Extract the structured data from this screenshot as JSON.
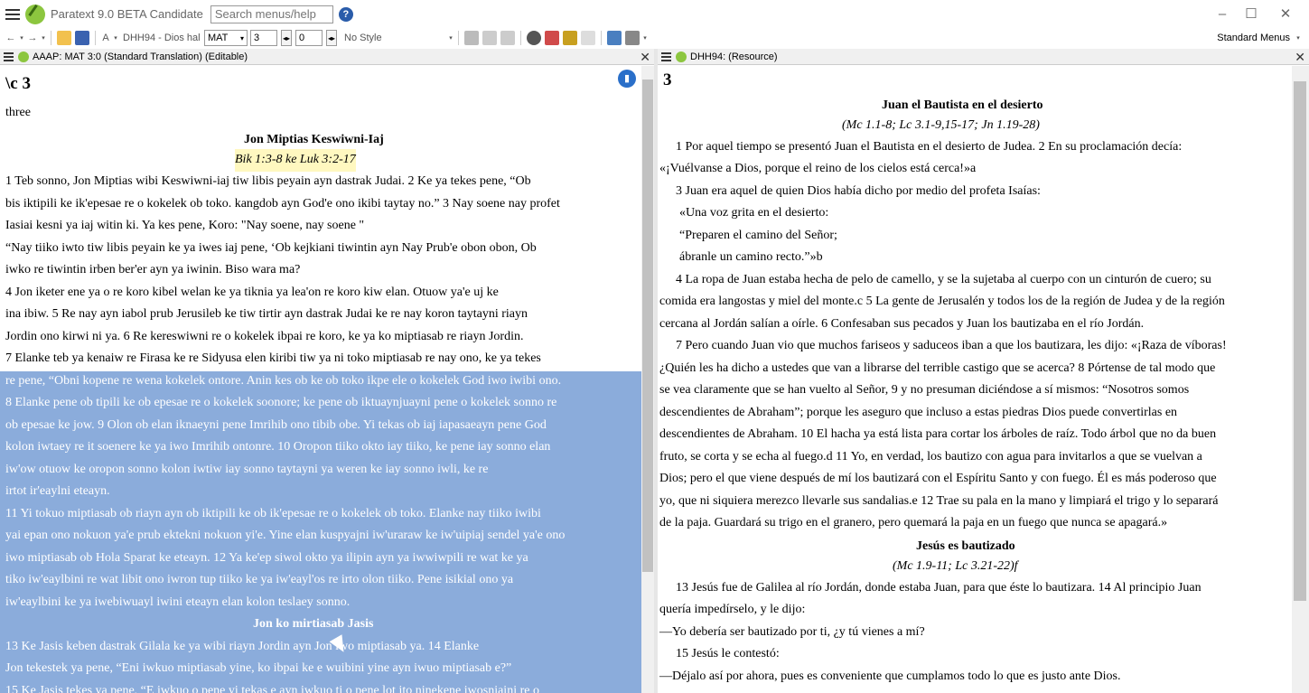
{
  "window": {
    "title": "Paratext 9.0 BETA Candidate",
    "search_placeholder": "Search menus/help",
    "help_glyph": "?",
    "minimize": "–",
    "maximize": "☐",
    "close": "✕"
  },
  "toolbar": {
    "font_label": "A",
    "resource_label": "DHH94 - Dios hal",
    "book": "MAT",
    "chapter": "3",
    "verse": "0",
    "style": "No Style",
    "menus_label": "Standard Menus"
  },
  "left_pane": {
    "title": "AAAP: MAT 3:0 (Standard Translation) (Editable)",
    "close": "✕",
    "lines": [
      "\\c 3",
      "three",
      "Jon Miptias Keswiwni-Iaj",
      "Bik 1:3-8 ke Luk 3:2-17",
      "1 Teb sonno, Jon Miptias wibi Keswiwni-iaj tiw libis peyain ayn dastrak Judai. 2 Ke ya tekes pene, “Ob",
      "bis iktipili ke ik'epesae re o kokelek ob toko. kangdob ayn God'e ono ikibi taytay no.” 3 Nay soene nay profet",
      "Iasiai kesni ya iaj witin ki. Ya kes pene, Koro: \"Nay soene, nay soene \"",
      "“Nay tiiko iwto tiw libis peyain ke ya iwes iaj pene, ‘Ob kejkiani tiwintin ayn Nay Prub'e obon obon, Ob",
      "iwko re tiwintin irben ber'er ayn ya iwinin. Biso wara ma?",
      "4 Jon iketer ene ya o re koro kibel welan ke ya tiknia ya lea'on re koro kiw elan. Otuow ya'e uj ke",
      "ina ibiw. 5 Re nay ayn iabol prub Jerusileb ke tiw tirtir ayn dastrak Judai ke re nay koron taytayni riayn",
      "Jordin ono kirwi ni ya. 6 Re kereswiwni re o kokelek ibpai re koro, ke ya ko miptiasab re riayn Jordin.",
      "7 Elanke teb ya kenaiw re Firasa ke re Sidyusa elen kiribi tiw ya ni toko miptiasab re nay ono, ke ya tekes",
      "re pene, “Obni kopene re wena kokelek ontore. Anin kes ob ke ob toko ikpe ele o kokelek God iwo iwibi ono.",
      "8 Elanke pene ob tipili ke ob epesae re o kokelek soonore; ke pene ob iktuaynjuayni pene o kokelek sonno re",
      "ob epesae ke jow. 9 Olon ob elan iknaeyni pene Imrihib ono tibib obe. Yi tekas ob iaj iapasaeayn pene God",
      "kolon iwtaey re it soenere ke ya iwo Imrihib ontonre. 10 Oropon tiiko okto iay tiiko, ke pene iay sonno elan",
      "iw'ow otuow ke oropon sonno kolon iwtiw iay sonno taytayni ya weren ke iay sonno iwli, ke re",
      "irtot ir'eaylni eteayn.",
      "11 Yi tokuo miptiasab ob riayn ayn ob iktipili ke ob ik'epesae re o kokelek ob toko. Elanke nay tiiko iwibi",
      "yai epan ono nokuon ya'e prub ektekni nokuon yi'e. Yine elan kuspyajni iw'uraraw ke iw'uipiaj sendel ya'e ono",
      "iwo miptiasab ob Hola Sparat ke eteayn. 12 Ya ke'ep siwol okto ya ilipin ayn ya iwwiwpili re wat ke ya",
      "tiko iw'eaylbini re wat libit ono iwron tup tiiko ke ya iw'eayl'os re irto olon tiiko. Pene isikial ono ya",
      "iw'eaylbini ke ya iwebiwuayl iwini eteayn elan kolon teslaey sonno.",
      "Jon ko mirtiasab Jasis",
      "13 Ke Jasis keben dastrak Gilala ke ya wibi riayn Jordin ayn Jon iwo miptiasab ya. 14 Elanke",
      "Jon tekestek ya pene, “Eni iwkuo miptiasab yine, ko ibpai ke e wuibini yine ayn iwuo miptiasab e?”",
      "15 Ke Jasis tekes ya pene, “E iwkuo o pene yi tekas e ayn iwkuo ti o pene lot ito ninekene iwosniaini re o"
    ]
  },
  "right_pane": {
    "title": "DHH94:  (Resource)",
    "close": "✕",
    "chapter": "3",
    "heading1": "Juan el Bautista en el desierto",
    "ref1": "(Mc 1.1-8; Lc 3.1-9,15-17; Jn 1.19-28)",
    "lines": [
      "1 Por aquel tiempo se presentó Juan el Bautista en el desierto de Judea. 2 En su proclamación decía:",
      "«¡Vuélvanse a Dios, porque el reino de los cielos está cerca!»a",
      "3 Juan era aquel de quien Dios había dicho por medio del profeta Isaías:",
      "«Una voz grita en el desierto:",
      "“Preparen el camino del Señor;",
      "ábranle un camino recto.”»b",
      "4 La ropa de Juan estaba hecha de pelo de camello, y se la sujetaba al cuerpo con un cinturón de cuero; su",
      "comida era langostas y miel del monte.c 5 La gente de Jerusalén y todos los de la región de Judea y de la región",
      "cercana al Jordán salían a oírle. 6 Confesaban sus pecados y Juan los bautizaba en el río Jordán.",
      "7 Pero cuando Juan vio que muchos fariseos y saduceos iban a que los bautizara, les dijo: «¡Raza de víboras!",
      "¿Quién les ha dicho a ustedes que van a librarse del terrible castigo que se acerca? 8 Pórtense de tal modo que",
      "se vea claramente que se han vuelto al Señor, 9 y no presuman diciéndose a sí mismos: “Nosotros somos",
      "descendientes de Abraham”; porque les aseguro que incluso a estas piedras Dios puede convertirlas en",
      "descendientes de Abraham. 10 El hacha ya está lista para cortar los árboles de raíz. Todo árbol que no da buen",
      "fruto, se corta y se echa al fuego.d 11 Yo, en verdad, los bautizo con agua para invitarlos a que se vuelvan a",
      "Dios; pero el que viene después de mí los bautizará con el Espíritu Santo y con fuego. Él es más poderoso que",
      "yo, que ni siquiera merezco llevarle sus sandalias.e 12 Trae su pala en la mano y limpiará el trigo y lo separará",
      "de la paja. Guardará su trigo en el granero, pero quemará la paja en un fuego que nunca se apagará.»"
    ],
    "heading2": "Jesús es bautizado",
    "ref2": "(Mc 1.9-11; Lc 3.21-22)f",
    "lines2": [
      "13 Jesús fue de Galilea al río Jordán, donde estaba Juan, para que éste lo bautizara. 14 Al principio Juan",
      "quería impedírselo, y le dijo:",
      "—Yo debería ser bautizado por ti, ¿y tú vienes a mí?",
      "15 Jesús le contestó:",
      "—Déjalo así por ahora, pues es conveniente que cumplamos todo lo que es justo ante Dios."
    ]
  }
}
